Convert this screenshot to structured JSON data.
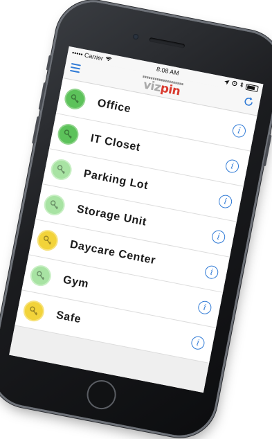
{
  "status_bar": {
    "carrier": "••••• Carrier",
    "wifi_icon": "wifi-icon",
    "time": "8:08 AM",
    "icons": [
      "location-icon",
      "alarm-icon",
      "bluetooth-icon",
      "battery-icon"
    ]
  },
  "nav": {
    "menu_icon": "hamburger-menu-icon",
    "logo_part1": "viz",
    "logo_part2": "pin",
    "refresh_icon": "refresh-icon"
  },
  "colors": {
    "accent": "#2f7ad6",
    "logo_red": "#d93a2f",
    "green_dark": "#5cc25a",
    "green_light": "#a8e3a3",
    "yellow": "#f2d33a"
  },
  "locks": [
    {
      "label": "Office",
      "status_color": "#5cc25a",
      "ring": "#8fd48b"
    },
    {
      "label": "IT Closet",
      "status_color": "#5cc25a",
      "ring": "#8fd48b"
    },
    {
      "label": "Parking Lot",
      "status_color": "#a8e3a3",
      "ring": "#c8efc4"
    },
    {
      "label": "Storage Unit",
      "status_color": "#a8e3a3",
      "ring": "#c8efc4"
    },
    {
      "label": "Daycare Center",
      "status_color": "#f2d33a",
      "ring": "#f7e27c"
    },
    {
      "label": "Gym",
      "status_color": "#a8e3a3",
      "ring": "#c8efc4"
    },
    {
      "label": "Safe",
      "status_color": "#f2d33a",
      "ring": "#f7e27c"
    }
  ],
  "row_icon": "key-icon",
  "info_glyph": "i"
}
